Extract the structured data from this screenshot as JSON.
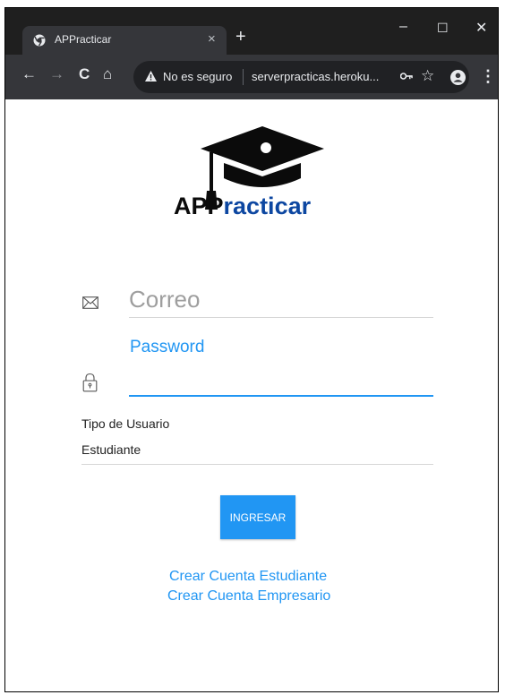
{
  "browser": {
    "tab_title": "APPracticar",
    "tab_close": "×",
    "new_tab": "+",
    "controls": {
      "minimize": "–",
      "maximize": "☐",
      "close": "✕"
    },
    "nav": {
      "back": "←",
      "forward": "→",
      "reload": "C",
      "home": "⌂"
    },
    "security_text": "No es seguro",
    "url": "serverpracticas.heroku...",
    "bookmark_star": "☆",
    "menu": "⋮"
  },
  "logo": {
    "text_main": "APP",
    "text_accent": "racticar"
  },
  "form": {
    "email_placeholder": "Correo",
    "password_label": "Password",
    "user_type_label": "Tipo de Usuario",
    "user_type_value": "Estudiante",
    "submit_label": "INGRESAR"
  },
  "links": {
    "create_student": "Crear Cuenta Estudiante",
    "create_company": "Crear Cuenta Empresario"
  },
  "colors": {
    "accent": "#2196f3",
    "logo_accent": "#0d47a1",
    "chrome_dark": "#35363a",
    "titlebar": "#1f1f1f"
  },
  "icons": {
    "favicon": "chrome-page-icon",
    "email": "envelope-icon",
    "password": "lock-icon",
    "key": "key-icon",
    "account": "account-icon",
    "warning": "warning-icon",
    "logo": "graduation-cap-icon"
  }
}
